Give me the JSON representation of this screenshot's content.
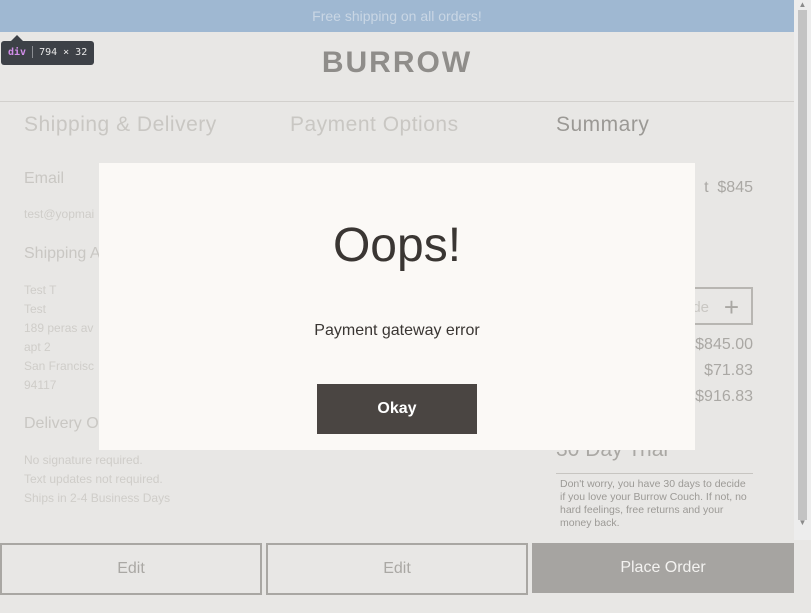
{
  "banner": {
    "text": "Free shipping on all orders!"
  },
  "devtools_tooltip": {
    "tag": "div",
    "size": "794 × 32"
  },
  "header": {
    "logo": "BURROW"
  },
  "columns": {
    "shipping_title": "Shipping & Delivery",
    "payment_title": "Payment Options",
    "summary_title": "Summary"
  },
  "shipping": {
    "email_label": "Email",
    "email_value": "test@yopmai",
    "address_label": "Shipping A",
    "address_lines": [
      "Test T",
      "Test",
      "189 peras av",
      "apt 2",
      "San Francisc",
      "94117"
    ],
    "delivery_label": "Delivery O",
    "delivery_lines": [
      "No signature required.",
      "Text updates not required.",
      "Ships in 2-4 Business Days"
    ]
  },
  "summary": {
    "item_label": "t",
    "item_value": "$845",
    "promo_label": "de",
    "promo_icon": "plus-icon",
    "subtotal_value": "$845.00",
    "tax_value": "$71.83",
    "total_value": "$916.83",
    "trial_title": "30 Day Trial",
    "trial_text": "Don't worry, you have 30 days to decide if you love your Burrow Couch. If not, no hard feelings, free returns and your money back."
  },
  "footer": {
    "edit_shipping": "Edit",
    "edit_payment": "Edit",
    "place_order": "Place Order"
  },
  "modal": {
    "title": "Oops!",
    "message": "Payment gateway error",
    "button": "Okay"
  }
}
